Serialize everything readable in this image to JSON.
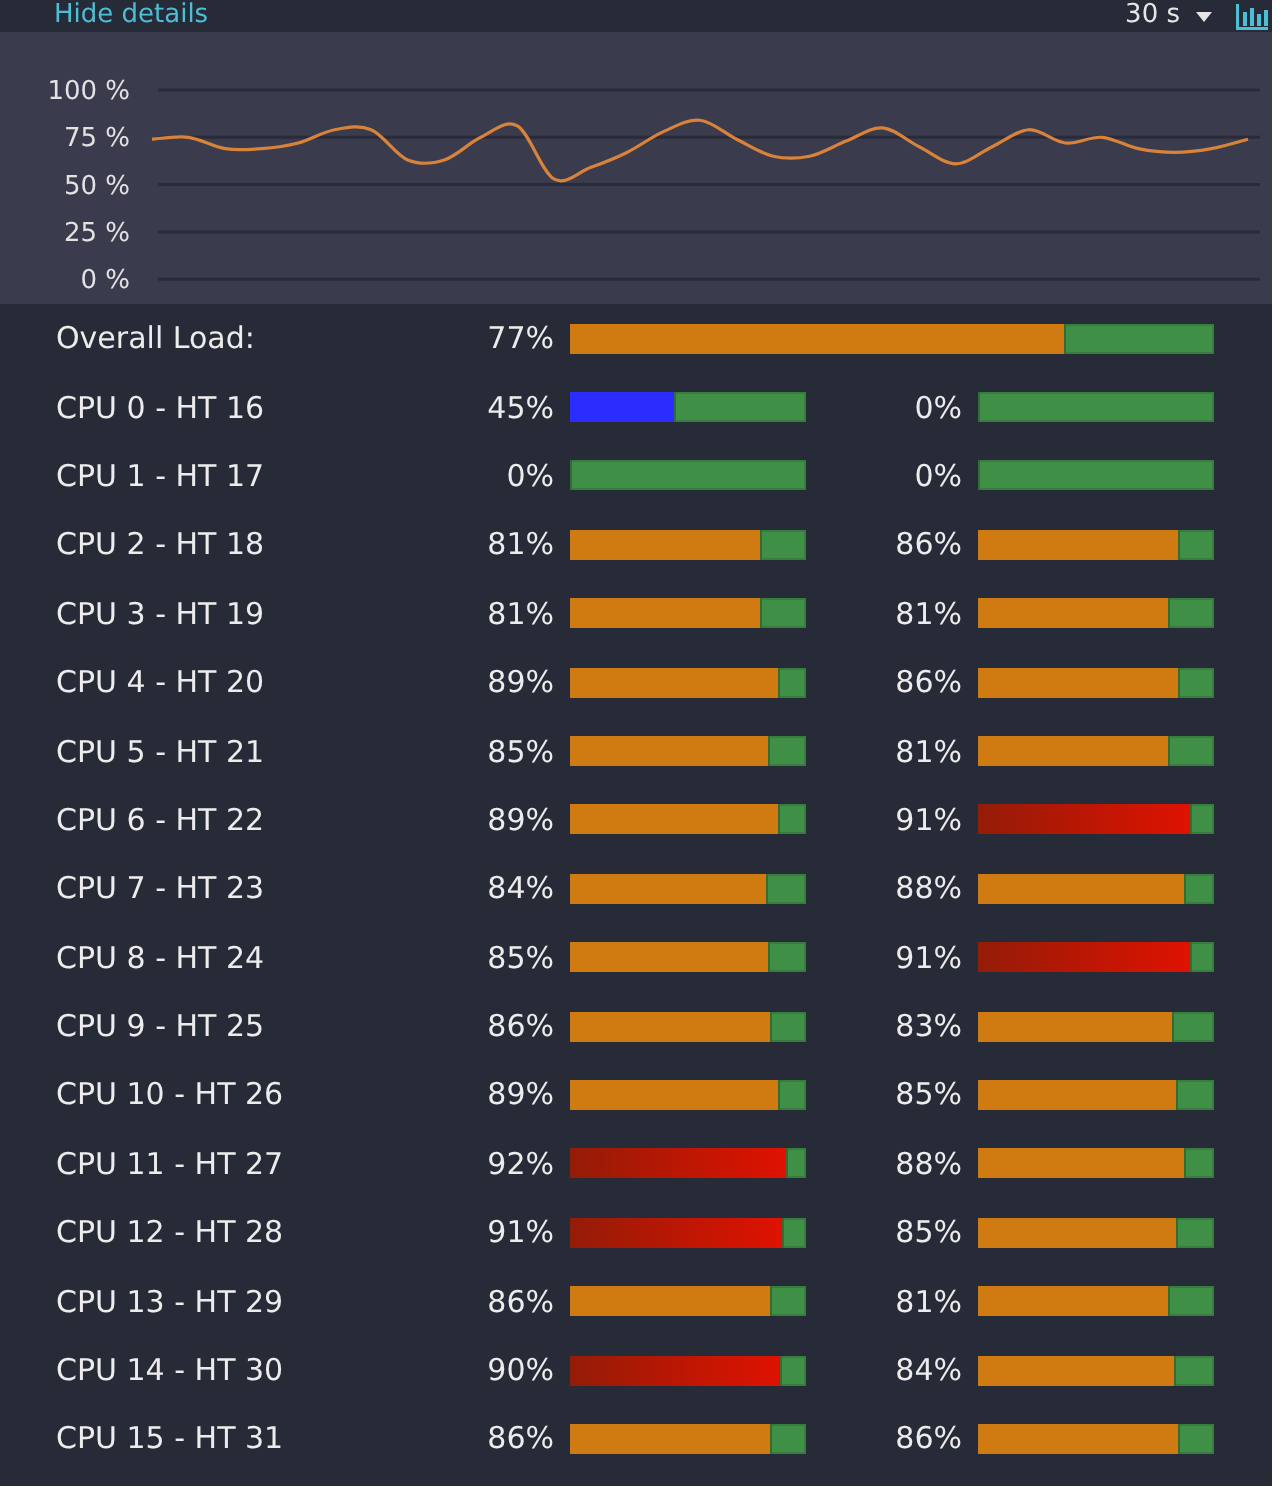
{
  "toolbar": {
    "details_link": "Hide details",
    "time_range": "30 s"
  },
  "chart": {
    "chart_data": {
      "type": "line",
      "grid": true,
      "ylim": [
        0,
        100
      ],
      "yticks": [
        {
          "value": 100,
          "label": "100 %"
        },
        {
          "value": 75,
          "label": "75 %"
        },
        {
          "value": 50,
          "label": "50 %"
        },
        {
          "value": 25,
          "label": "25 %"
        },
        {
          "value": 0,
          "label": "0 %"
        }
      ],
      "series": [
        {
          "color": "#d9823a",
          "values": [
            74,
            75,
            69,
            69,
            72,
            79,
            79,
            63,
            63,
            75,
            81,
            53,
            59,
            67,
            78,
            84,
            74,
            65,
            65,
            73,
            80,
            70,
            61,
            70,
            79,
            72,
            75,
            69,
            67,
            69,
            74
          ]
        }
      ]
    }
  },
  "overall": {
    "label": "Overall Load:",
    "reading": "77%",
    "level": 0.77
  },
  "cpus": [
    {
      "label": "CPU 0 - HT 16",
      "core": {
        "reading": "45%",
        "level": 0.45
      },
      "ht": {
        "reading": "0%",
        "level": 0
      }
    },
    {
      "label": "CPU 1 - HT 17",
      "core": {
        "reading": "0%",
        "level": 0
      },
      "ht": {
        "reading": "0%",
        "level": 0
      }
    },
    {
      "label": "CPU 2 - HT 18",
      "core": {
        "reading": "81%",
        "level": 0.81
      },
      "ht": {
        "reading": "86%",
        "level": 0.86
      }
    },
    {
      "label": "CPU 3 - HT 19",
      "core": {
        "reading": "81%",
        "level": 0.81
      },
      "ht": {
        "reading": "81%",
        "level": 0.81
      }
    },
    {
      "label": "CPU 4 - HT 20",
      "core": {
        "reading": "89%",
        "level": 0.89
      },
      "ht": {
        "reading": "86%",
        "level": 0.86
      }
    },
    {
      "label": "CPU 5 - HT 21",
      "core": {
        "reading": "85%",
        "level": 0.85
      },
      "ht": {
        "reading": "81%",
        "level": 0.81
      }
    },
    {
      "label": "CPU 6 - HT 22",
      "core": {
        "reading": "89%",
        "level": 0.89
      },
      "ht": {
        "reading": "91%",
        "level": 0.91
      }
    },
    {
      "label": "CPU 7 - HT 23",
      "core": {
        "reading": "84%",
        "level": 0.84
      },
      "ht": {
        "reading": "88%",
        "level": 0.88
      }
    },
    {
      "label": "CPU 8 - HT 24",
      "core": {
        "reading": "85%",
        "level": 0.85
      },
      "ht": {
        "reading": "91%",
        "level": 0.91
      }
    },
    {
      "label": "CPU 9 - HT 25",
      "core": {
        "reading": "86%",
        "level": 0.86
      },
      "ht": {
        "reading": "83%",
        "level": 0.83
      }
    },
    {
      "label": "CPU 10 - HT 26",
      "core": {
        "reading": "89%",
        "level": 0.89
      },
      "ht": {
        "reading": "85%",
        "level": 0.85
      }
    },
    {
      "label": "CPU 11 - HT 27",
      "core": {
        "reading": "92%",
        "level": 0.92
      },
      "ht": {
        "reading": "88%",
        "level": 0.88
      }
    },
    {
      "label": "CPU 12 - HT 28",
      "core": {
        "reading": "91%",
        "level": 0.91
      },
      "ht": {
        "reading": "85%",
        "level": 0.85
      }
    },
    {
      "label": "CPU 13 - HT 29",
      "core": {
        "reading": "86%",
        "level": 0.86
      },
      "ht": {
        "reading": "81%",
        "level": 0.81
      }
    },
    {
      "label": "CPU 14 - HT 30",
      "core": {
        "reading": "90%",
        "level": 0.9
      },
      "ht": {
        "reading": "84%",
        "level": 0.84
      }
    },
    {
      "label": "CPU 15 - HT 31",
      "core": {
        "reading": "86%",
        "level": 0.86
      },
      "ht": {
        "reading": "86%",
        "level": 0.86
      }
    }
  ]
}
